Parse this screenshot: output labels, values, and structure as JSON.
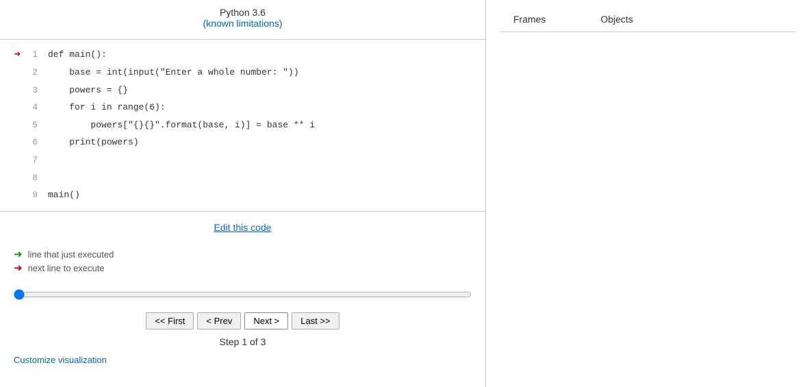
{
  "header": {
    "title": "Python 3.6",
    "link_text": "(known limitations)",
    "link_href": "#"
  },
  "code": {
    "lines": [
      {
        "num": 1,
        "code": "def main():",
        "arrow": "red"
      },
      {
        "num": 2,
        "code": "    base = int(input(\"Enter a whole number: \"))",
        "arrow": "none"
      },
      {
        "num": 3,
        "code": "    powers = {}",
        "arrow": "none"
      },
      {
        "num": 4,
        "code": "    for i in range(6):",
        "arrow": "none"
      },
      {
        "num": 5,
        "code": "        powers[\"{}{}\".format(base, i)] = base ** i",
        "arrow": "none"
      },
      {
        "num": 6,
        "code": "    print(powers)",
        "arrow": "none"
      },
      {
        "num": 7,
        "code": "",
        "arrow": "none"
      },
      {
        "num": 8,
        "code": "",
        "arrow": "none"
      },
      {
        "num": 9,
        "code": "main()",
        "arrow": "none"
      }
    ]
  },
  "edit_link": "Edit this code",
  "legend": {
    "green_label": "line that just executed",
    "red_label": "next line to execute"
  },
  "controls": {
    "first_label": "<< First",
    "prev_label": "< Prev",
    "next_label": "Next >",
    "last_label": "Last >>"
  },
  "step_text": "Step 1 of 3",
  "customize_label": "Customize visualization",
  "right_panel": {
    "col1": "Frames",
    "col2": "Objects"
  }
}
